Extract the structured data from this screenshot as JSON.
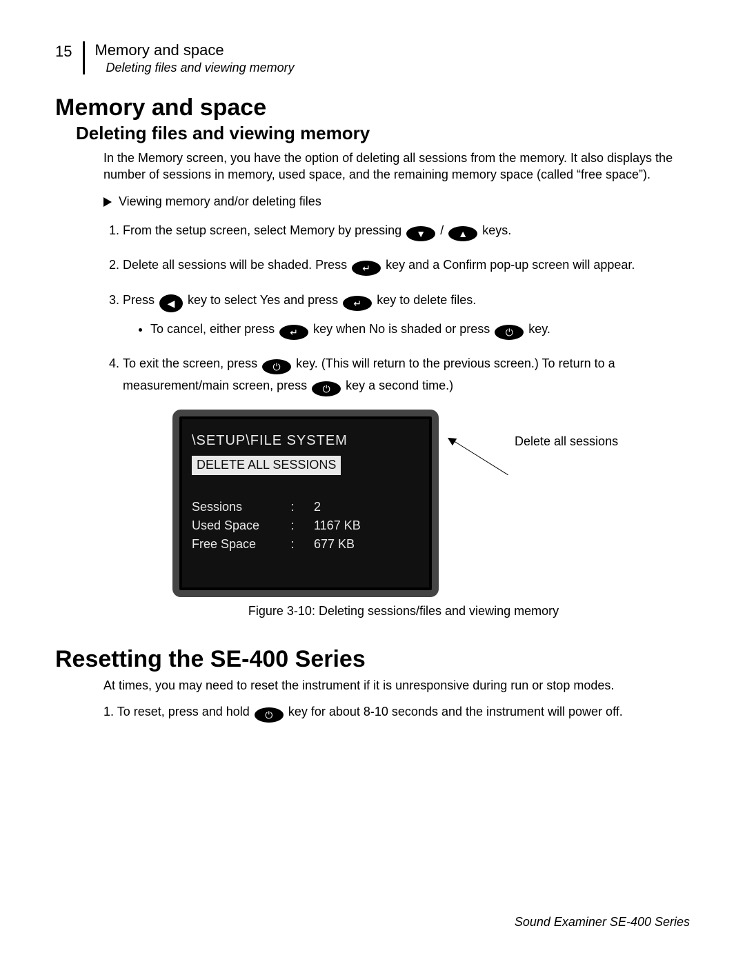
{
  "header": {
    "page_number": "15",
    "title": "Memory and space",
    "subtitle": "Deleting files and viewing memory"
  },
  "section1": {
    "heading": "Memory and space",
    "subheading": "Deleting files and viewing memory",
    "intro": "In the Memory screen, you have the option of deleting all sessions from the memory.  It also displays the number of sessions in memory, used space, and the remaining memory space (called “free space”).",
    "bullet": "Viewing memory and/or deleting files",
    "step1a": "From the setup screen, select ",
    "step1b": "Memory",
    "step1c": " by pressing ",
    "step1d": " / ",
    "step1e": " keys.",
    "step2a": "Delete all sessions",
    "step2b": " will be shaded.  Press ",
    "step2c": " key and a Confirm pop-up screen will appear.",
    "step3a": "Press ",
    "step3b": " key to select ",
    "step3c": "Yes",
    "step3d": " and press ",
    "step3e": " key to delete files.",
    "sub1a": "To cancel, either press ",
    "sub1b": " key when ",
    "sub1c": "No",
    "sub1d": " is shaded or press ",
    "sub1e": " key.",
    "step4a": "To exit the screen, press ",
    "step4b": " key.  (This will return to the previous screen.)  To return to a measurement/main screen, press ",
    "step4c": " key a second time.)"
  },
  "lcd": {
    "title": "\\SETUP\\FILE SYSTEM",
    "highlight": "DELETE ALL SESSIONS",
    "rows": [
      {
        "label": "Sessions",
        "value": "2"
      },
      {
        "label": "Used Space",
        "value": "1167 KB"
      },
      {
        "label": "Free Space",
        "value": "677 KB"
      }
    ]
  },
  "callout": "Delete all sessions",
  "figure_caption": "Figure 3-10:  Deleting sessions/files and viewing memory",
  "section2": {
    "heading": "Resetting the SE-400 Series",
    "intro": "At times, you may need to reset the instrument if it is unresponsive during run or stop modes.",
    "step1a": "1. To reset, press and hold ",
    "step1b": " key for about 8-10 seconds and the instrument will power off."
  },
  "footer": "Sound Examiner SE-400 Series",
  "glyphs": {
    "down": "▼",
    "up": "▲",
    "enter": "↵",
    "left": "◀",
    "onoff": "⏻"
  }
}
